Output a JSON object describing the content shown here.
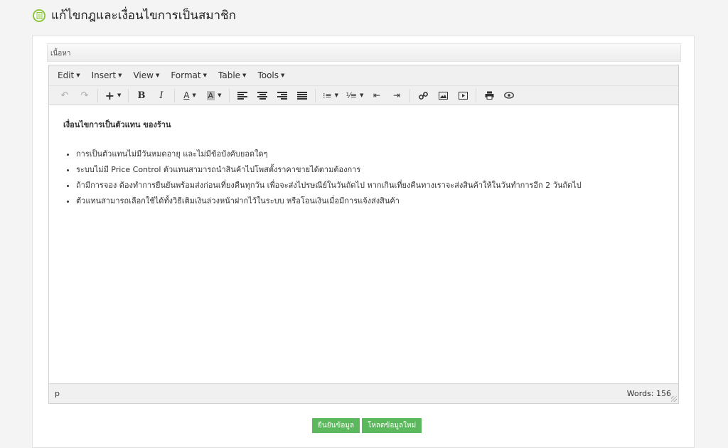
{
  "page": {
    "title": "แก้ไขกฎและเงื่อนไขการเป็นสมาชิก"
  },
  "section": {
    "label": "เนื้อหา"
  },
  "menubar": [
    {
      "label": "Edit"
    },
    {
      "label": "Insert"
    },
    {
      "label": "View"
    },
    {
      "label": "Format"
    },
    {
      "label": "Table"
    },
    {
      "label": "Tools"
    }
  ],
  "content": {
    "heading": "เงื่อนไขการเป็นตัวแทน ของร้าน",
    "items": [
      "การเป็นตัวแทนไม่มีวันหมดอายุ และไม่มีข้อบังคับยอดใดๆ",
      "ระบบไม่มี Price Control ตัวแทนสามารถนำสินค้าไปโพสตั้งราคาขายได้ตามต้องการ",
      "ถ้ามีการจอง ต้องทำการยืนยันพร้อมส่งก่อนเที่ยงคืนทุกวัน เพื่อจะส่งไปรษณีย์ในวันถัดไป หากเกินเที่ยงคืนทางเราจะส่งสินค้าให้ในวันทำการอีก 2 วันถัดไป",
      "ตัวแทนสามารถเลือกใช้ได้ทั้งวิธีเติมเงินล่วงหน้าฝากไว้ในระบบ หรือโอนเงินเมื่อมีการแจ้งส่งสินค้า"
    ]
  },
  "statusbar": {
    "path": "p",
    "words": "Words: 156"
  },
  "actions": {
    "confirm": "ยืนยันข้อมูล",
    "reload": "โหลดข้อมูลใหม่"
  },
  "colors": {
    "accent": "#8cc63f",
    "button": "#5cb85c"
  }
}
